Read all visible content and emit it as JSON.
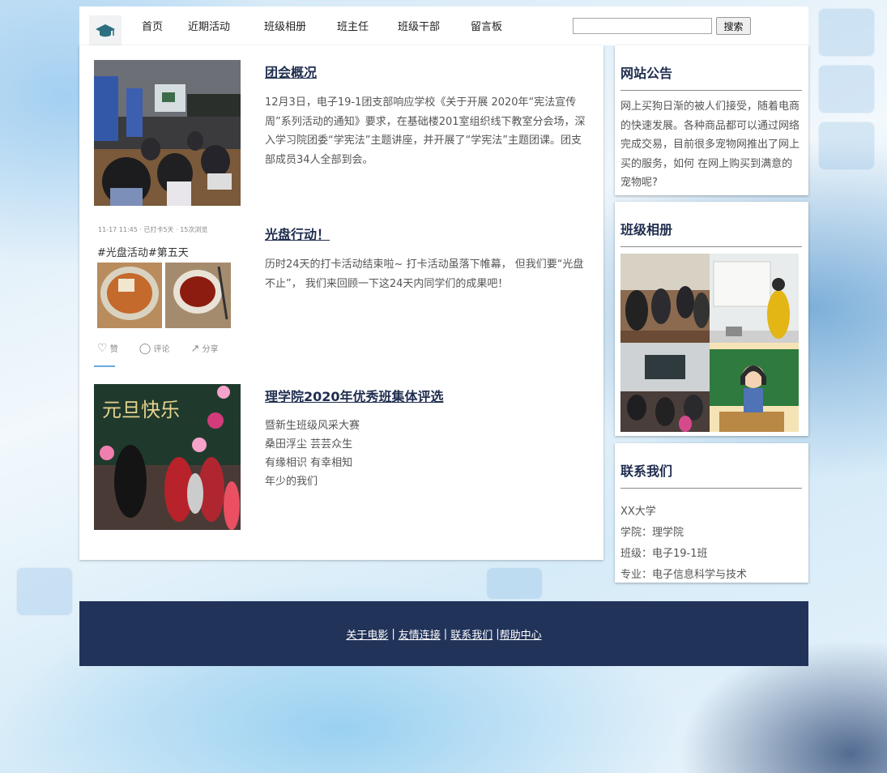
{
  "nav": {
    "items": [
      "首页",
      "近期活动",
      "班级相册",
      "班主任",
      "班级干部",
      "留言板"
    ],
    "search_placeholder": "",
    "search_button": "搜索"
  },
  "articles": [
    {
      "title": "团会概况",
      "text": "12月3日，电子19-1团支部响应学校《关于开展 2020年“宪法宣传周”系列活动的通知》要求，在基础楼201室组织线下教室分会场，深入学习院团委“学宪法”主题讲座，并开展了“学宪法”主题团课。团支部成员34人全部到会。"
    },
    {
      "title": "光盘行动！",
      "text": "历时24天的打卡活动结束啦~ 打卡活动虽落下帷幕， 但我们要“光盘不止”， 我们来回顾一下这24天内同学们的成果吧！",
      "thumb": {
        "meta": "11-17 11:45 · 已打卡5天 · 15次浏览",
        "tag": "#光盘活动#第五天",
        "like": "赞",
        "comment": "评论",
        "share": "分享"
      }
    },
    {
      "title": "理学院2020年优秀班集体评选",
      "lines": [
        "暨新生班级风采大赛",
        "桑田浮尘 芸芸众生",
        "有缘相识 有幸相知",
        "年少的我们"
      ]
    }
  ],
  "sidebar": {
    "notice": {
      "title": "网站公告",
      "text": "网上买狗日渐的被人们接受，随着电商 的快速发展。各种商品都可以通过网络完成交易，目前很多宠物网推出了网上买的服务，如何 在网上购买到满意的宠物呢?"
    },
    "album": {
      "title": "班级相册"
    },
    "contact": {
      "title": "联系我们",
      "lines": [
        "XX大学",
        "学院：理学院",
        "班级：电子19-1班",
        "专业：电子信息科学与技术"
      ]
    }
  },
  "footer": {
    "links": [
      "关于电影",
      "友情连接",
      "联系我们",
      "帮助中心"
    ],
    "separator": "|"
  },
  "colors": {
    "title": "#1f2d4e",
    "footer_bg": "#22335a",
    "text": "#555555"
  }
}
